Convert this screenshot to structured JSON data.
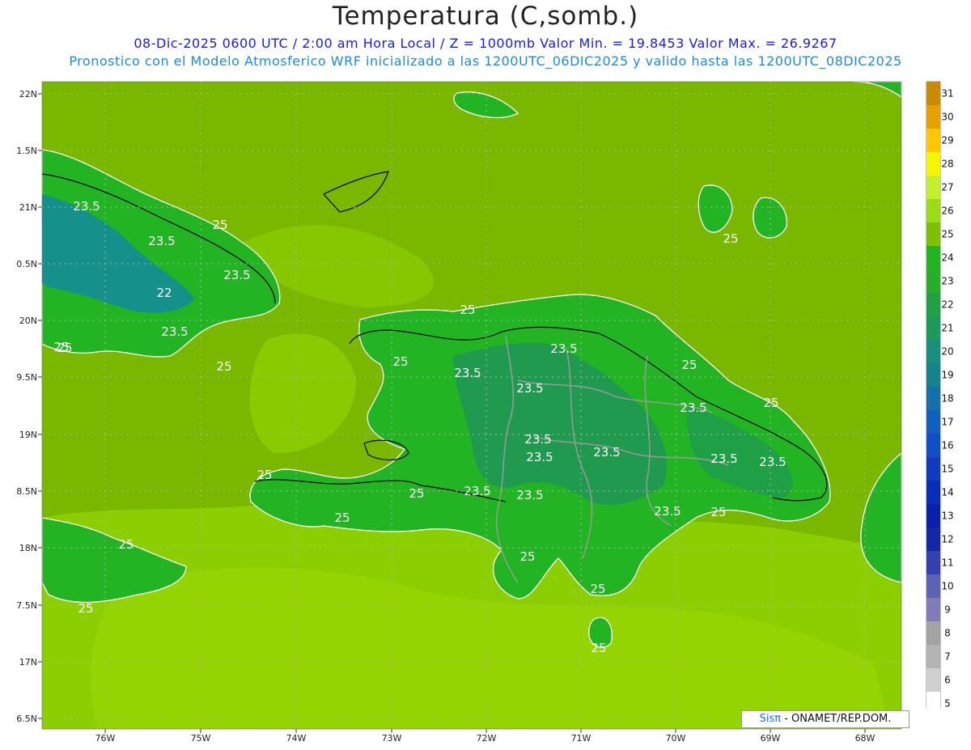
{
  "header": {
    "title": "Temperatura (C,somb.)",
    "subtitle_line1": "08-Dic-2025  0600 UTC / 2:00 am Hora Local / Z = 1000mb   Valor Min. = 19.8453  Valor Max. = 26.9267",
    "subtitle_line2": "Pronostico con el Modelo Atmosferico WRF inicializado a las 1200UTC_06DIC2025 y valido hasta las  1200UTC_08DIC2025"
  },
  "map": {
    "lat_labels": [
      "22N",
      "1.5N",
      "21N",
      "0.5N",
      "20N",
      "9.5N",
      "19N",
      "8.5N",
      "18N",
      "7.5N",
      "17N",
      "6.5N"
    ],
    "lon_labels": [
      "76W",
      "75W",
      "74W",
      "73W",
      "72W",
      "71W",
      "70W",
      "69W",
      "68W"
    ],
    "contour_labels": [
      {
        "text": "23.5",
        "at": "Cuba east"
      },
      {
        "text": "25",
        "at": "Cuba north coast"
      },
      {
        "text": "23.5",
        "at": "Cuba interior"
      },
      {
        "text": "23.5",
        "at": "Cuba east interior"
      },
      {
        "text": "22",
        "at": "Cuba interior"
      },
      {
        "text": "23.5",
        "at": "Cuba south"
      },
      {
        "text": "25",
        "at": "Cuba south coast"
      },
      {
        "text": "25",
        "at": "Windward Passage"
      },
      {
        "text": "25",
        "at": "Hispaniola north coast"
      },
      {
        "text": "25",
        "at": "Haiti north"
      },
      {
        "text": "23.5",
        "at": "Haiti north"
      },
      {
        "text": "23.5",
        "at": "Cordillera Central"
      },
      {
        "text": "23.5",
        "at": "Haiti central"
      },
      {
        "text": "25",
        "at": "Samana"
      },
      {
        "text": "23.5",
        "at": "DR east"
      },
      {
        "text": "25",
        "at": "Hispaniola NE coast"
      },
      {
        "text": "23.5",
        "at": "DR central"
      },
      {
        "text": "23.5",
        "at": "Haiti south"
      },
      {
        "text": "23.5",
        "at": "DR central"
      },
      {
        "text": "23.5",
        "at": "DR east"
      },
      {
        "text": "23.5",
        "at": "DR far east"
      },
      {
        "text": "25",
        "at": "Tiburon peninsula west"
      },
      {
        "text": "25",
        "at": "Tiburon peninsula"
      },
      {
        "text": "25",
        "at": "Tiburon peninsula south"
      },
      {
        "text": "23.5",
        "at": "Haiti south"
      },
      {
        "text": "23.5",
        "at": "DR south"
      },
      {
        "text": "23.5",
        "at": "DR southeast"
      },
      {
        "text": "25",
        "at": "DR south coast"
      },
      {
        "text": "25",
        "at": "Jamaica"
      },
      {
        "text": "25",
        "at": "Jamaica south"
      },
      {
        "text": "25",
        "at": "Pedernales"
      },
      {
        "text": "25",
        "at": "Beata sea"
      },
      {
        "text": "25",
        "at": "Caribbean south"
      },
      {
        "text": "25",
        "at": "Turks and Caicos"
      },
      {
        "text": "25",
        "at": "Mona passage"
      }
    ]
  },
  "colorbar": {
    "levels": [
      "31",
      "30",
      "29",
      "28",
      "27",
      "26",
      "25",
      "24",
      "23",
      "22",
      "21",
      "20",
      "19",
      "18",
      "17",
      "16",
      "15",
      "14",
      "13",
      "12",
      "11",
      "10",
      "9",
      "8",
      "7",
      "6",
      "5"
    ],
    "colors": [
      "#c98b00",
      "#e6a000",
      "#ffc800",
      "#f6f600",
      "#c3f02c",
      "#9cdc17",
      "#7cc000",
      "#22b422",
      "#28ae28",
      "#22a046",
      "#1d9a5a",
      "#188f7c",
      "#16828f",
      "#1470aa",
      "#1160c0",
      "#0f4fc8",
      "#0d3cc0",
      "#0a2db8",
      "#0a20ad",
      "#1428a5",
      "#3440ac",
      "#5a62b4",
      "#7f7cb8",
      "#a3a3a3",
      "#b4b4b4",
      "#d0d0d0",
      "#ffffff"
    ]
  },
  "credit": {
    "logo_text": "Sisπ",
    "text": "- ONAMET/REP.DOM."
  }
}
